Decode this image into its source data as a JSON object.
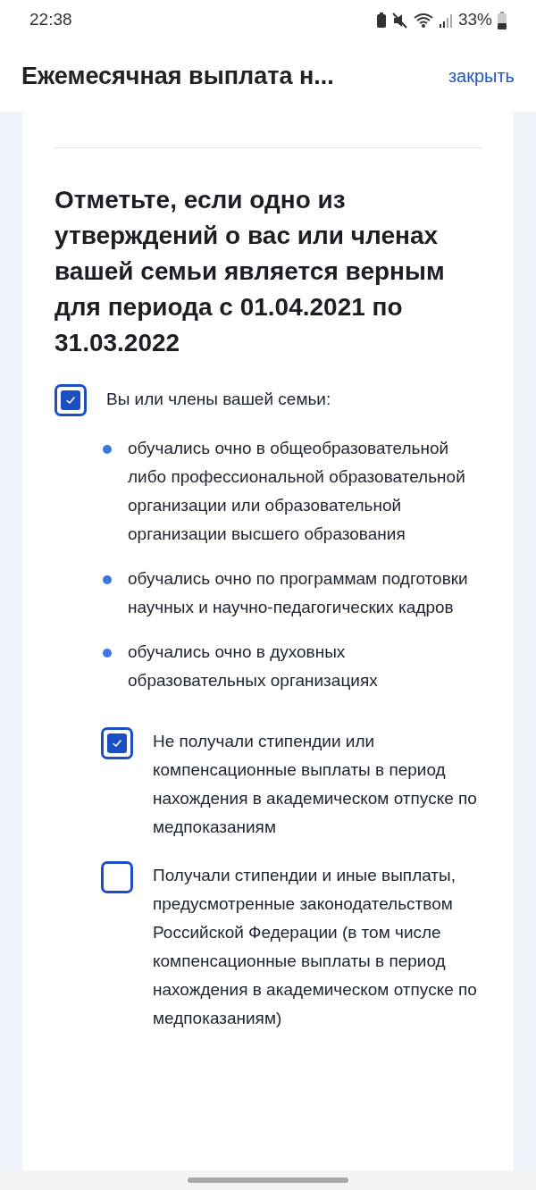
{
  "status_bar": {
    "time": "22:38",
    "battery": "33%"
  },
  "header": {
    "title": "Ежемесячная выплата н...",
    "close": "закрыть"
  },
  "question": {
    "title": "Отметьте, если одно из утверждений о вас или членах вашей семьи является верным для периода с 01.04.2021 по 31.03.2022"
  },
  "options": [
    {
      "label": "Вы или члены вашей семьи:",
      "checked": true,
      "bullets": [
        "обучались очно в общеобразовательной либо профессиональной образовательной организации или образовательной организации высшего образования",
        "обучались очно по программам подготовки научных и научно-педагогических кадров",
        "обучались очно в духовных образовательных организациях"
      ],
      "children": [
        {
          "label": "Не получали стипендии или компенсационные выплаты в период нахождения в академическом отпуске по медпоказаниям",
          "checked": true
        },
        {
          "label": "Получали стипендии и иные выплаты, предусмотренные законодательством Российской Федерации (в том числе компенсационные выплаты в период нахождения в академическом отпуске по медпоказаниям)",
          "checked": false
        }
      ]
    }
  ]
}
